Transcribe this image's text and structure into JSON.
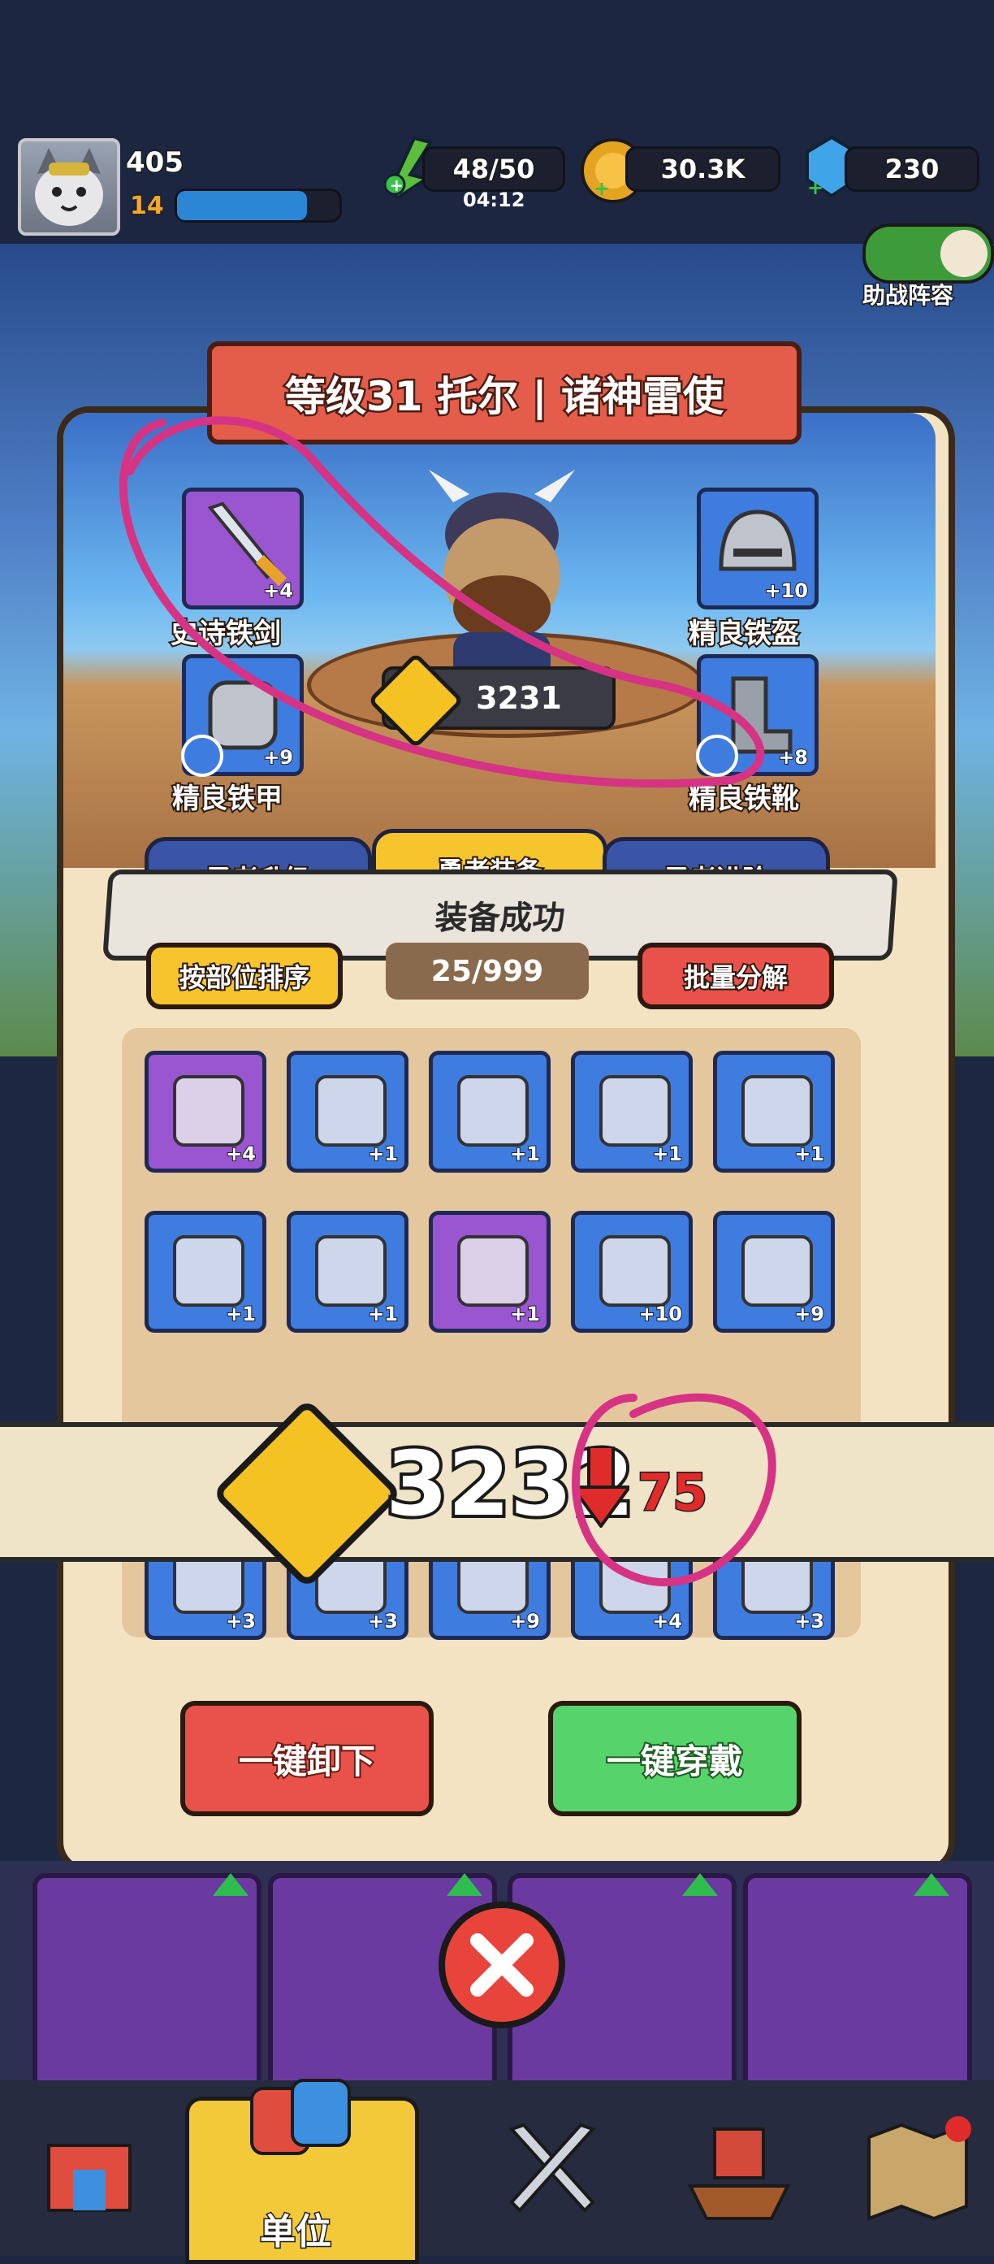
{
  "player": {
    "level_number": "405",
    "xp_level": "14",
    "xp_progress": 0.8
  },
  "resources": {
    "energy": "48/50",
    "energy_timer": "04:12",
    "coins": "30.3K",
    "gems": "230"
  },
  "support_toggle_label": "助战阵容",
  "hero": {
    "title": "等级31 托尔 | 诸神雷使",
    "power": "3231"
  },
  "equipment_slots": [
    {
      "name": "史诗铁剑",
      "plus": "+4"
    },
    {
      "name": "精良铁盔",
      "plus": "+10"
    },
    {
      "name": "精良铁甲",
      "plus": "+9"
    },
    {
      "name": "精良铁靴",
      "plus": "+8"
    }
  ],
  "tabs": [
    {
      "label": "勇者升级"
    },
    {
      "label": "勇者装备"
    },
    {
      "label": "勇者进阶"
    }
  ],
  "toast": "装备成功",
  "sort_button": "按部位排序",
  "inventory_count": "25/999",
  "bulk_button": "批量分解",
  "inventory": [
    {
      "plus": "+4"
    },
    {
      "plus": "+1"
    },
    {
      "plus": "+1"
    },
    {
      "plus": "+1"
    },
    {
      "plus": "+1"
    },
    {
      "plus": "+1"
    },
    {
      "plus": "+1"
    },
    {
      "plus": "+1"
    },
    {
      "plus": "+10"
    },
    {
      "plus": "+9"
    },
    {
      "plus": "+3"
    },
    {
      "plus": "+3"
    },
    {
      "plus": "+9"
    },
    {
      "plus": "+4"
    },
    {
      "plus": "+3"
    }
  ],
  "power_change": {
    "value": "3232",
    "delta": "75"
  },
  "unequip_all": "一键卸下",
  "equip_all": "一键穿戴",
  "nav": {
    "active_label": "单位"
  }
}
